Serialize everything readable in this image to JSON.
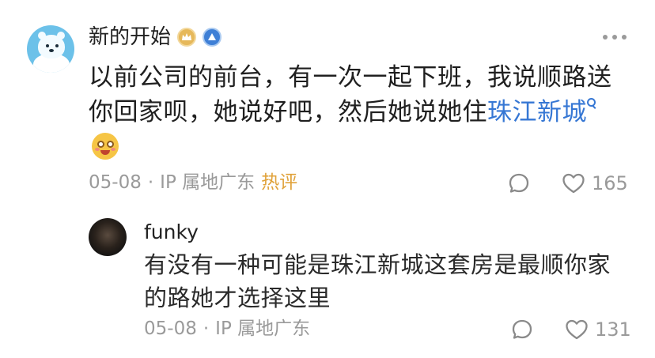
{
  "post": {
    "username": "新的开始",
    "text_before_link": "以前公司的前台，有一次一起下班，我说顺路送你回家呗，她说好吧，然后她说她住",
    "link_text": "珠江新城",
    "date": "05-08",
    "location": "IP 属地广东",
    "hot_tag": "热评",
    "like_count": "165"
  },
  "reply": {
    "username": "funky",
    "text": "有没有一种可能是珠江新城这套房是最顺你家的路她才选择这里",
    "date": "05-08",
    "location": "IP 属地广东",
    "like_count": "131"
  },
  "icons": {
    "badges": [
      "gold-level-badge-icon",
      "blue-verified-badge-icon"
    ],
    "more": "more-dots-icon",
    "comment": "comment-bubble-icon",
    "like": "heart-icon",
    "search": "search-icon",
    "emoji": "flushed-face-emoji-icon"
  },
  "colors": {
    "link": "#3677d4",
    "hot_tag": "#e0a23a",
    "meta": "#9a9a9a"
  }
}
